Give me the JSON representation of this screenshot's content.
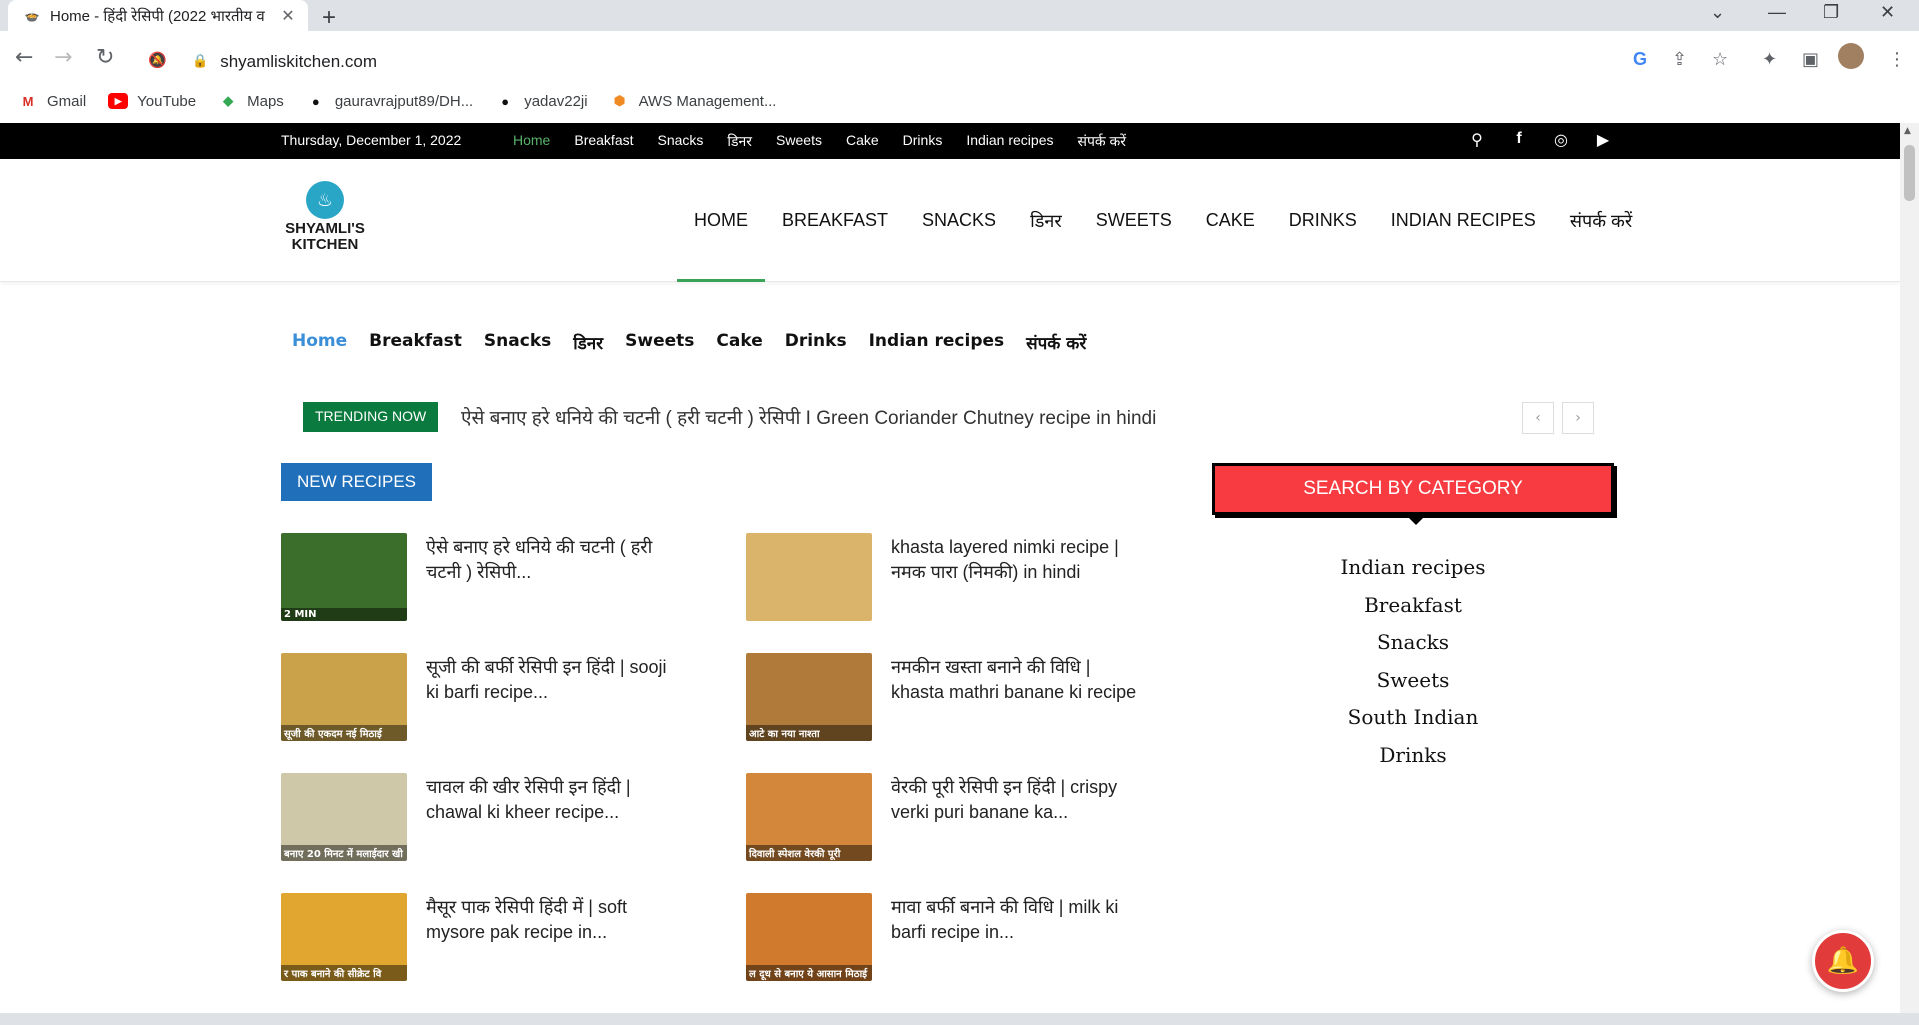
{
  "browser": {
    "tab_title": "Home - हिंदी रेसिपी (2022 भारतीय व",
    "new_tab": "+",
    "url": "shyamliskitchen.com",
    "bookmarks": [
      {
        "label": "Gmail",
        "icon": "gmail-icon"
      },
      {
        "label": "YouTube",
        "icon": "youtube-icon"
      },
      {
        "label": "Maps",
        "icon": "maps-icon"
      },
      {
        "label": "gauravrajput89/DH...",
        "icon": "github-icon"
      },
      {
        "label": "yadav22ji",
        "icon": "github-icon"
      },
      {
        "label": "AWS Management...",
        "icon": "aws-icon"
      }
    ]
  },
  "topbar": {
    "date": "Thursday, December 1, 2022",
    "menu": [
      "Home",
      "Breakfast",
      "Snacks",
      "डिनर",
      "Sweets",
      "Cake",
      "Drinks",
      "Indian recipes",
      "संपर्क करें"
    ]
  },
  "logo": {
    "line1": "SHYAMLI'S",
    "line2": "KITCHEN"
  },
  "mainnav": [
    "HOME",
    "BREAKFAST",
    "SNACKS",
    "डिनर",
    "SWEETS",
    "CAKE",
    "DRINKS",
    "INDIAN RECIPES",
    "संपर्क करें"
  ],
  "subnav": [
    "Home",
    "Breakfast",
    "Snacks",
    "डिनर",
    "Sweets",
    "Cake",
    "Drinks",
    "Indian recipes",
    "संपर्क करें"
  ],
  "trending": {
    "label": "TRENDING NOW",
    "text": "ऐसे बनाए हरे धनिये की चटनी ( हरी चटनी ) रेसिपी I Green Coriander Chutney recipe in hindi",
    "prev": "‹",
    "next": "›"
  },
  "new_recipes": {
    "label": "NEW RECIPES",
    "items": [
      {
        "title": "ऐसे बनाए हरे धनिये की चटनी ( हरी चटनी ) रेसिपी...",
        "caption": "2 MIN",
        "color": "#3b6e2a"
      },
      {
        "title": "khasta layered nimki recipe | नमक पारा (निमकी) in hindi",
        "caption": "",
        "color": "#d9b46a"
      },
      {
        "title": "सूजी की बर्फी रेसिपी इन हिंदी | sooji ki barfi recipe...",
        "caption": "सूजी की एकदम नई मिठाई",
        "color": "#c9a24a"
      },
      {
        "title": "नमकीन खस्ता बनाने की विधि | khasta mathri banane ki recipe",
        "caption": "आटे का नया नाश्ता",
        "color": "#b07a3a"
      },
      {
        "title": "चावल की खीर रेसिपी इन हिंदी | chawal ki kheer recipe...",
        "caption": "बनाए 20 मिनट में मलाईदार खी",
        "color": "#cfc8a8"
      },
      {
        "title": "वेरकी पूरी रेसिपी इन हिंदी | crispy verki puri banane ka...",
        "caption": "दिवाली स्पेशल वेरकी पूरी",
        "color": "#d2873a"
      },
      {
        "title": "मैसूर पाक रेसिपी हिंदी में | soft mysore pak recipe in...",
        "caption": "र पाक बनाने की सीक्रेट वि",
        "color": "#e0a630"
      },
      {
        "title": "मावा बर्फी बनाने की विधि | milk ki barfi recipe in...",
        "caption": "ल दूध से बनाए ये आसान मिठाई",
        "color": "#cf7a2c"
      }
    ]
  },
  "sidebar": {
    "heading": "SEARCH BY CATEGORY",
    "categories": [
      "Indian recipes",
      "Breakfast",
      "Snacks",
      "Sweets",
      "South Indian",
      "Drinks"
    ]
  }
}
